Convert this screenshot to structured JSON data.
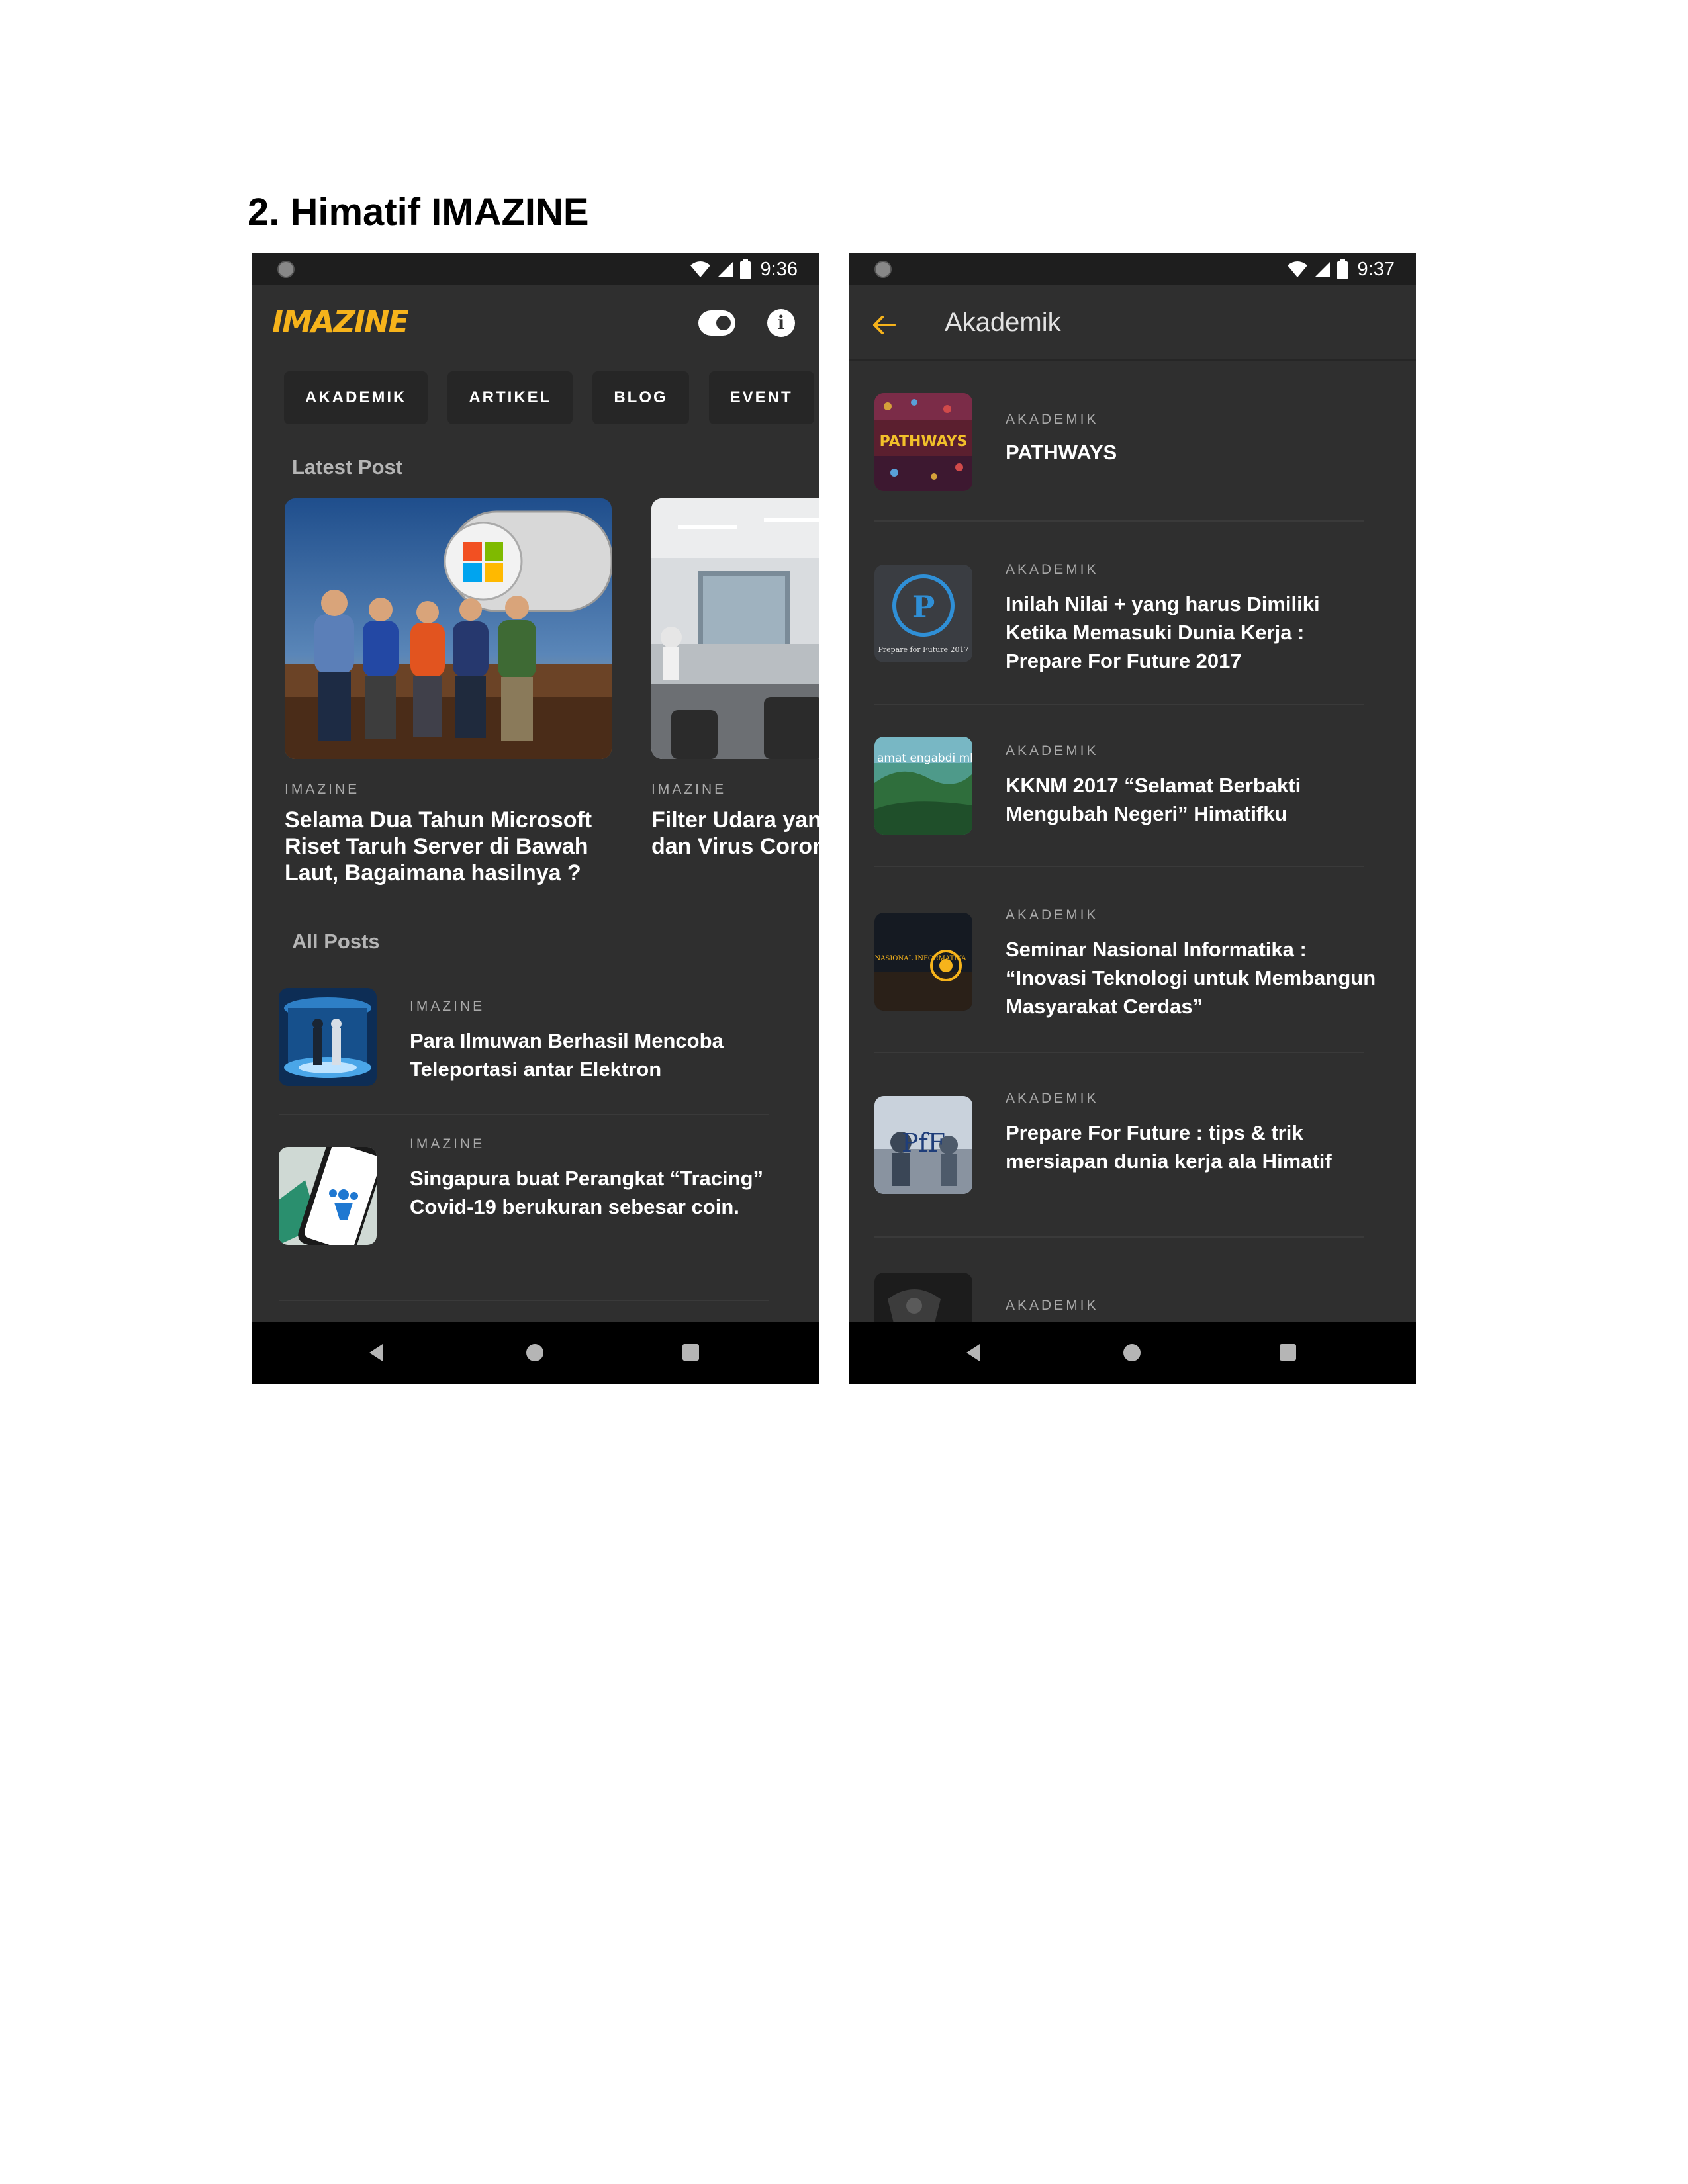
{
  "document": {
    "heading": "2.  Himatif IMAZINE"
  },
  "left": {
    "status": {
      "time": "9:36"
    },
    "logo": "IMAZINE",
    "chips": [
      "AKADEMIK",
      "ARTIKEL",
      "BLOG",
      "EVENT"
    ],
    "latest_title": "Latest Post",
    "cards": [
      {
        "tag": "IMAZINE",
        "title": "Selama Dua Tahun Microsoft Riset Taruh Server di Bawah Laut, Bagaimana hasilnya ?"
      },
      {
        "tag": "IMAZINE",
        "title": "Filter Udara yang menangkap dan Virus Corona"
      }
    ],
    "all_title": "All Posts",
    "posts": [
      {
        "tag": "IMAZINE",
        "title": "Para Ilmuwan Berhasil Mencoba Teleportasi antar Elektron"
      },
      {
        "tag": "IMAZINE",
        "title": "Singapura buat Perangkat “Tracing” Covid-19 berukuran sebesar coin."
      }
    ]
  },
  "right": {
    "status": {
      "time": "9:37"
    },
    "title": "Akademik",
    "items": [
      {
        "tag": "AKADEMIK",
        "title": "PATHWAYS",
        "thumb_text": "PATHWAYS"
      },
      {
        "tag": "AKADEMIK",
        "title": "Inilah Nilai + yang harus Dimiliki Ketika Memasuki Dunia Kerja : Prepare For Future 2017",
        "thumb_text": "Prepare for Future 2017"
      },
      {
        "tag": "AKADEMIK",
        "title": "KKNM 2017 “Selamat Berbakti Mengubah Negeri” Himatifku",
        "thumb_text": "amat engabdi mbangun geri"
      },
      {
        "tag": "AKADEMIK",
        "title": "Seminar Nasional Informatika : “Inovasi Teknologi untuk Membangun Masyarakat Cerdas”",
        "thumb_text": "SEMINAR NASIONAL INFORMATIKA"
      },
      {
        "tag": "AKADEMIK",
        "title": "Prepare For Future : tips & trik mersiapan dunia kerja ala Himatif",
        "thumb_text": "PfF"
      },
      {
        "tag": "AKADEMIK",
        "title": ""
      }
    ]
  },
  "colors": {
    "accent": "#f6b31b",
    "background": "#2f2f2f",
    "chip": "#262626"
  }
}
